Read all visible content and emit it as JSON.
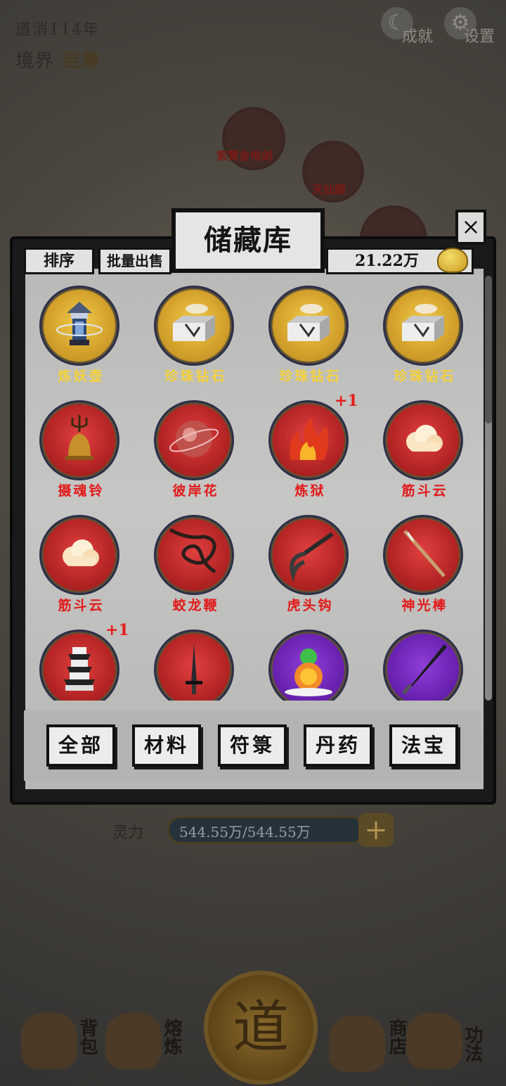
{
  "hud": {
    "era_text": "道消114年",
    "realm_label": "境界",
    "realm_value": "至尊",
    "achievements_label": "成就",
    "settings_label": "设置"
  },
  "background": {
    "orb_labels": [
      "紫霄金电剑",
      "天仙眼"
    ],
    "mana_label": "灵力",
    "mana_value": "544.55万/544.55万",
    "tao_char": "道",
    "bottom_nav": [
      "背包",
      "熔炼",
      "商店",
      "功法"
    ]
  },
  "dialog": {
    "title": "储藏库",
    "sort_label": "排序",
    "bulk_sell_label": "批量出售",
    "currency_value": "21.22万",
    "close_glyph": "×"
  },
  "items": [
    {
      "name": "炼妖壶",
      "rarity": "gold",
      "icon": "pagoda-lantern-icon",
      "badge": ""
    },
    {
      "name": "珍珠钻石",
      "rarity": "gold",
      "icon": "stone-block-icon",
      "badge": ""
    },
    {
      "name": "珍珠钻石",
      "rarity": "gold",
      "icon": "stone-block-icon",
      "badge": ""
    },
    {
      "name": "珍珠钻石",
      "rarity": "gold",
      "icon": "stone-block-icon",
      "badge": ""
    },
    {
      "name": "摄魂铃",
      "rarity": "red",
      "icon": "bell-trident-icon",
      "badge": ""
    },
    {
      "name": "彼岸花",
      "rarity": "red",
      "icon": "sphere-flower-icon",
      "badge": ""
    },
    {
      "name": "炼狱",
      "rarity": "red",
      "icon": "flame-icon",
      "badge": "+1"
    },
    {
      "name": "筋斗云",
      "rarity": "red",
      "icon": "cloud-icon",
      "badge": ""
    },
    {
      "name": "筋斗云",
      "rarity": "red",
      "icon": "cloud-icon",
      "badge": ""
    },
    {
      "name": "蛟龙鞭",
      "rarity": "red",
      "icon": "whip-icon",
      "badge": ""
    },
    {
      "name": "虎头钩",
      "rarity": "red",
      "icon": "hook-icon",
      "badge": ""
    },
    {
      "name": "神光棒",
      "rarity": "red",
      "icon": "staff-icon",
      "badge": ""
    },
    {
      "name": "",
      "rarity": "red",
      "icon": "tower-icon",
      "badge": "+1"
    },
    {
      "name": "",
      "rarity": "red",
      "icon": "sword-icon",
      "badge": ""
    },
    {
      "name": "",
      "rarity": "purple",
      "icon": "gourd-icon",
      "badge": ""
    },
    {
      "name": "",
      "rarity": "purple",
      "icon": "blade-icon",
      "badge": ""
    }
  ],
  "categories": [
    "全部",
    "材料",
    "符箓",
    "丹药",
    "法宝"
  ],
  "colors": {
    "gold_rarity": "#d4a22c",
    "red_rarity": "#b42424",
    "purple_rarity": "#6a22b0",
    "gold_text": "#f4d23a",
    "red_text": "#e21818"
  }
}
